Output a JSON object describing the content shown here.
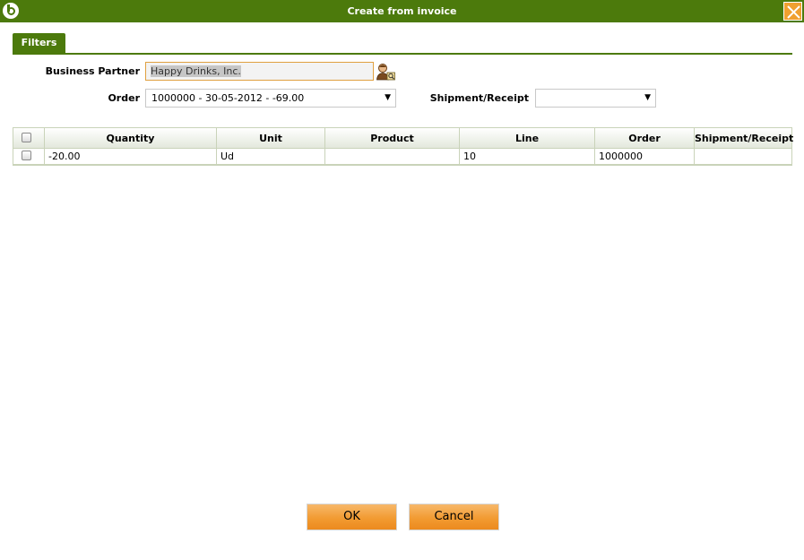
{
  "window": {
    "title": "Create from invoice"
  },
  "tabs": {
    "filters_label": "Filters"
  },
  "form": {
    "business_partner_label": "Business Partner",
    "business_partner_value": "Happy Drinks, Inc.",
    "order_label": "Order",
    "order_value": "1000000 - 30-05-2012 - -69.00",
    "shipment_label": "Shipment/Receipt",
    "shipment_value": ""
  },
  "grid": {
    "columns": [
      "Quantity",
      "Unit",
      "Product",
      "Line",
      "Order",
      "Shipment/Receipt"
    ],
    "rows": [
      {
        "quantity": "-20.00",
        "unit": "Ud",
        "product": "",
        "line": "10",
        "order": "1000000",
        "shipment": ""
      }
    ]
  },
  "buttons": {
    "ok_label": "OK",
    "cancel_label": "Cancel"
  },
  "icons": {
    "logo": "app-logo-icon",
    "close": "close-icon",
    "search": "business-partner-search-icon",
    "dropdown": "dropdown-arrow-icon"
  },
  "colors": {
    "primary_green": "#4c7a0c",
    "accent_orange": "#f29b32"
  }
}
